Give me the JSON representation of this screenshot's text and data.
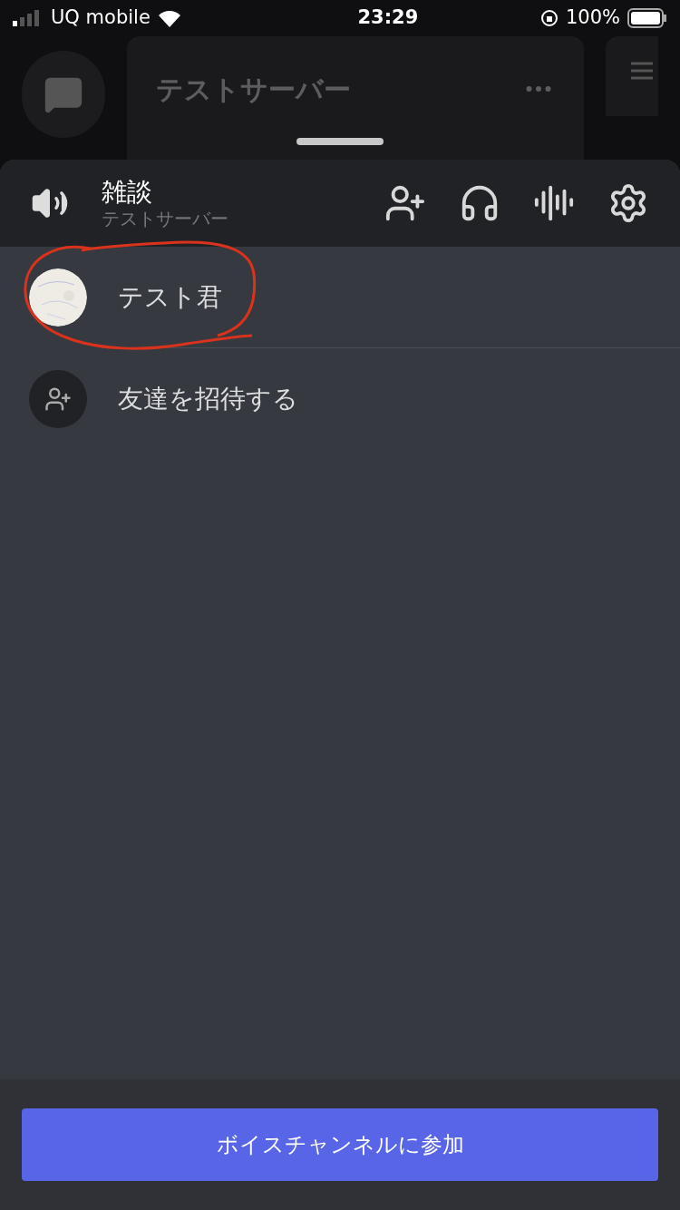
{
  "status_bar": {
    "carrier": "UQ mobile",
    "time": "23:29",
    "battery": "100%"
  },
  "background": {
    "server_name": "テストサーバー"
  },
  "channel": {
    "name": "雑談",
    "server": "テストサーバー"
  },
  "members": [
    {
      "kind": "user",
      "name": "テスト君"
    },
    {
      "kind": "invite",
      "name": "友達を招待する"
    }
  ],
  "join_button": "ボイスチャンネルに参加"
}
